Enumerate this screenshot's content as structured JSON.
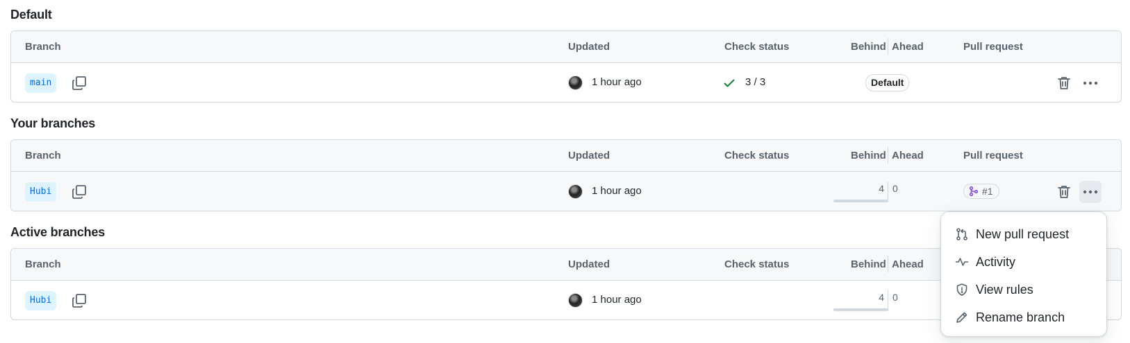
{
  "columns": {
    "branch": "Branch",
    "updated": "Updated",
    "check_status": "Check status",
    "behind": "Behind",
    "ahead": "Ahead",
    "pull_request": "Pull request"
  },
  "sections": {
    "default": {
      "title": "Default",
      "row": {
        "branch": "main",
        "updated": "1 hour ago",
        "check": "3 / 3",
        "badge": "Default"
      }
    },
    "yours": {
      "title": "Your branches",
      "row": {
        "branch": "Hubi",
        "updated": "1 hour ago",
        "behind": "4",
        "ahead": "0",
        "pr": "#1"
      }
    },
    "active": {
      "title": "Active branches",
      "row": {
        "branch": "Hubi",
        "updated": "1 hour ago",
        "behind": "4",
        "ahead": "0"
      }
    }
  },
  "menu": {
    "items": [
      {
        "label": "New pull request",
        "icon": "git-pull-request-icon"
      },
      {
        "label": "Activity",
        "icon": "pulse-icon"
      },
      {
        "label": "View rules",
        "icon": "shield-icon"
      },
      {
        "label": "Rename branch",
        "icon": "pencil-icon"
      }
    ]
  },
  "colors": {
    "branch_bg": "#ddf4ff",
    "branch_text": "#0969da",
    "success": "#1a7f37",
    "merged": "#8250df",
    "border": "#d1d9e0",
    "header_bg": "#f6f8fa"
  }
}
